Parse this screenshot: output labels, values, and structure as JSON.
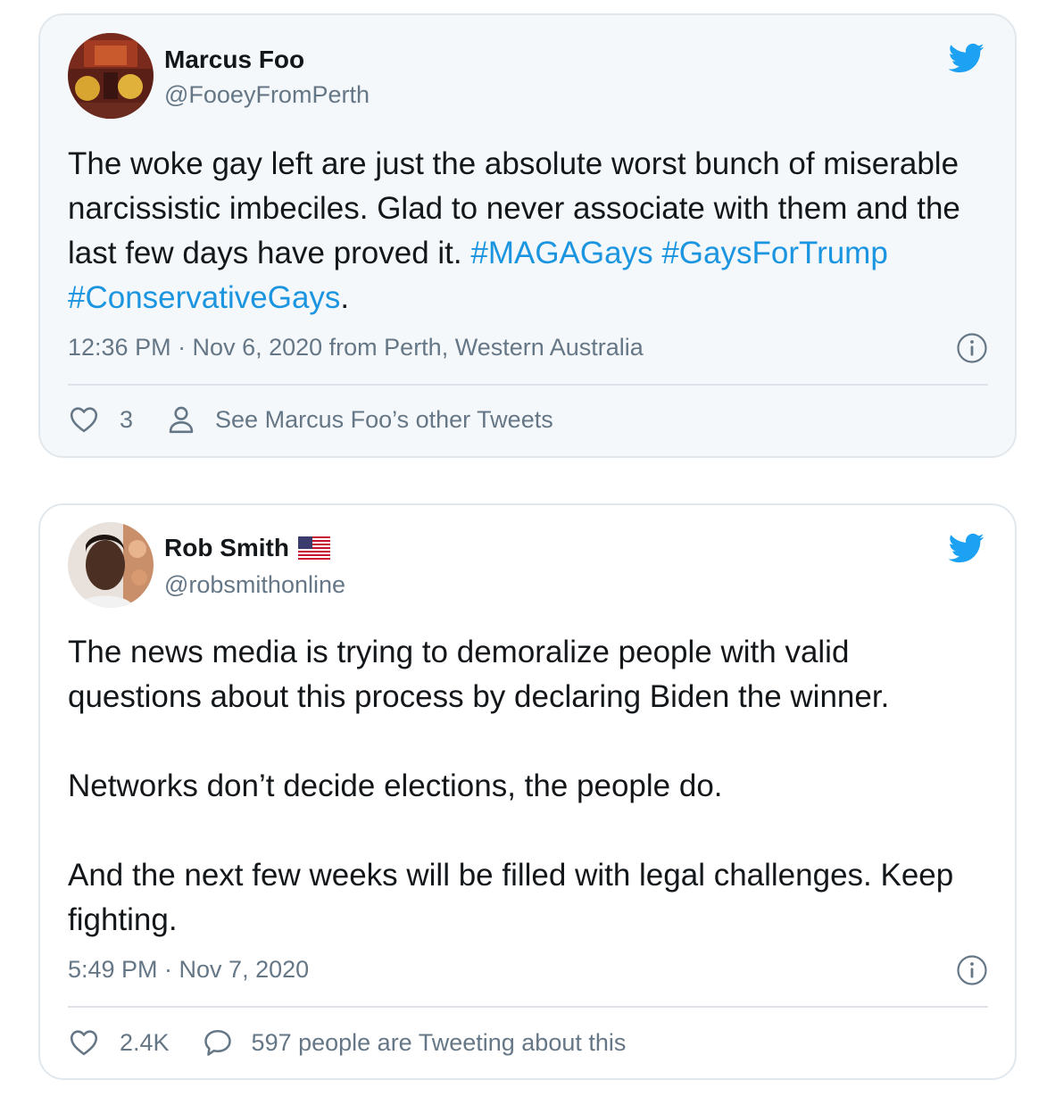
{
  "tweets": [
    {
      "author_name": "Marcus Foo",
      "handle": "@FooeyFromPerth",
      "text_plain": "The woke gay left are just the absolute worst bunch of miserable narcissistic imbeciles. Glad to never associate with them and the last few days have proved it.",
      "hashtags": [
        "#MAGAGays",
        "#GaysForTrump",
        "#ConservativeGays"
      ],
      "text_end": ".",
      "timestamp": "12:36 PM · Nov 6, 2020 from Perth, Western Australia",
      "likes": "3",
      "secondary_action": "See Marcus Foo’s other Tweets",
      "icons": {
        "brand": "twitter-bird-icon",
        "info": "info-icon",
        "like": "heart-icon",
        "secondary": "person-icon"
      }
    },
    {
      "author_name": "Rob Smith",
      "author_flag": "us-flag-icon",
      "handle": "@robsmithonline",
      "paragraphs": [
        "The news media is trying to demoralize people with valid questions about this process by declaring Biden the winner.",
        "Networks don’t decide elections, the people do.",
        "And the next few weeks will be filled with legal challenges. Keep fighting."
      ],
      "timestamp": "5:49 PM · Nov 7, 2020",
      "likes": "2.4K",
      "secondary_action": "597 people are Tweeting about this",
      "icons": {
        "brand": "twitter-bird-icon",
        "info": "info-icon",
        "like": "heart-icon",
        "secondary": "speech-bubble-icon"
      }
    }
  ],
  "colors": {
    "link": "#1b95e0",
    "brand": "#1da1f2",
    "muted": "#657786",
    "text": "#14171a",
    "card_border": "#e1e8ed",
    "card_one_bg": "#f5f8fa"
  }
}
